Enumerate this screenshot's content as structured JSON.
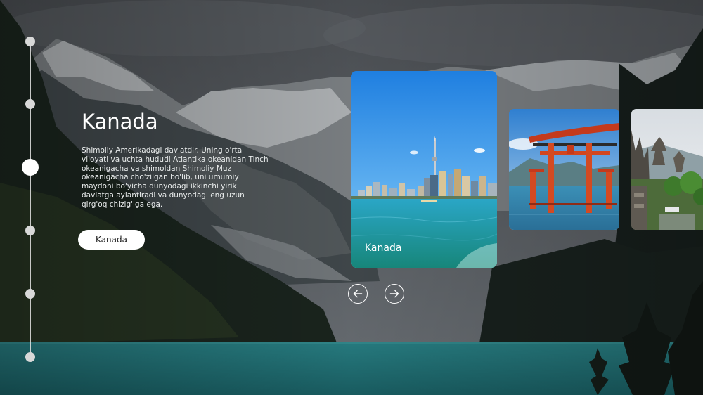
{
  "hero": {
    "title": "Kanada",
    "description": "Shimoliy Amerikadagi davlatdir. Uning o'rta viloyati va uchta hududi Atlantika okeanidan Tinch okeanigacha va shimoldan Shimoliy Muz okeanigacha cho'zilgan bo'lib, uni umumiy maydoni bo'yicha dunyodagi ikkinchi yirik davlatga aylantiradi va dunyodagi eng uzun qirg'oq chizig'iga ega.",
    "button_label": "Kanada"
  },
  "timeline": {
    "dots": 6,
    "active_index": 2
  },
  "cards": [
    {
      "label": "Kanada",
      "image": "toronto-skyline"
    },
    {
      "label": "",
      "image": "japanese-torii-gate"
    },
    {
      "label": "",
      "image": "balinese-temple"
    }
  ],
  "nav": {
    "prev_icon": "arrow-left-icon",
    "next_icon": "arrow-right-icon"
  },
  "colors": {
    "accent": "#ffffff",
    "lake": "#2a8a8e",
    "sky_card": "#2f8fe0"
  }
}
